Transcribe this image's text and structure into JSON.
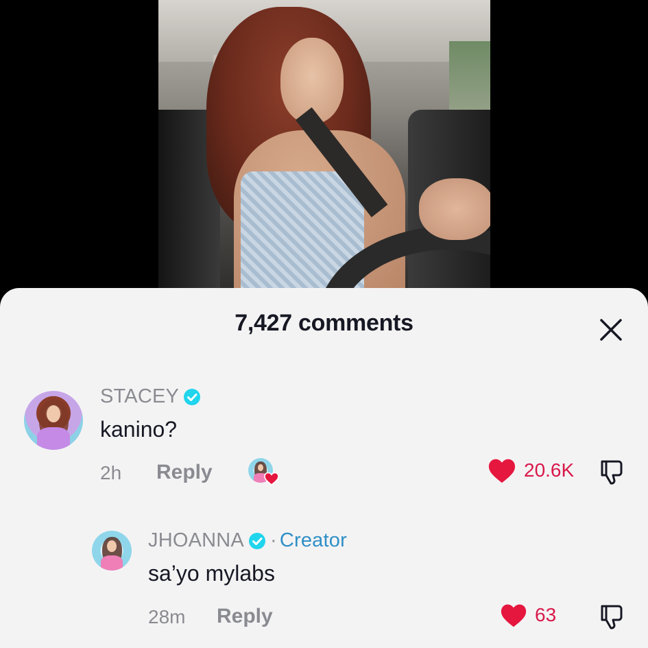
{
  "sheet": {
    "title": "7,427 comments"
  },
  "colors": {
    "heart": "#e5173f",
    "like_count_text": "#d8194a",
    "verified": "#20d5ec",
    "creator_label": "#2e8fc6",
    "sheet_background": "#f4f3f4"
  },
  "comments": [
    {
      "username": "STACEY",
      "verified": true,
      "text": "kanino?",
      "time": "2h",
      "reply_label": "Reply",
      "liked_by_creator": true,
      "likes": "20.6K"
    }
  ],
  "replies": [
    {
      "username": "JHOANNA",
      "verified": true,
      "separator": "·",
      "badge": "Creator",
      "text": "sa’yo mylabs",
      "time": "28m",
      "reply_label": "Reply",
      "likes": "63"
    }
  ],
  "icons": {
    "close": "close-icon",
    "verified": "verified-badge-icon",
    "like": "heart-icon",
    "dislike": "thumbs-down-icon"
  }
}
